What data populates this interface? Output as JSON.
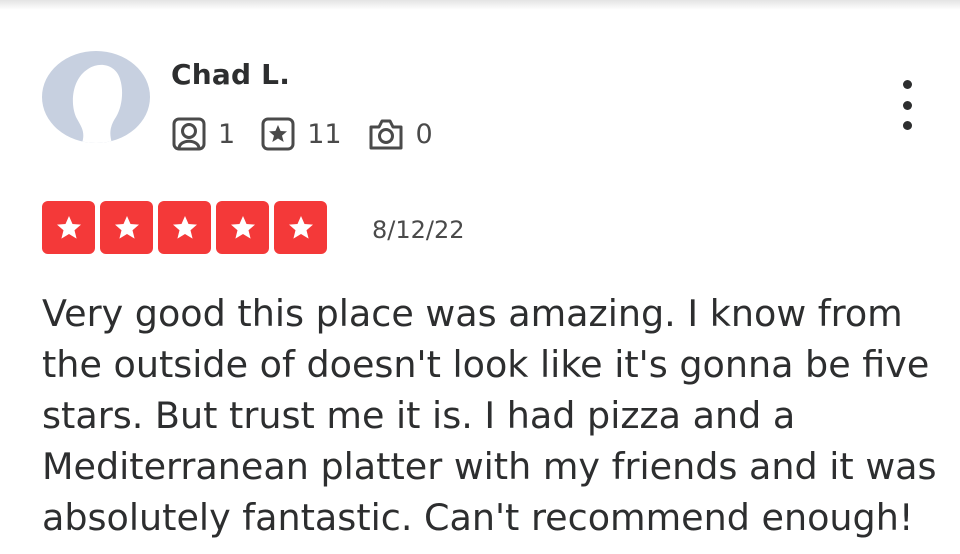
{
  "user": {
    "name": "Chad L.",
    "avatar_icon": "default-avatar-silhouette-icon",
    "stats": {
      "friends": "1",
      "reviews": "11",
      "photos": "0"
    }
  },
  "review": {
    "rating": 5,
    "rating_max": 5,
    "date": "8/12/22",
    "text": "Very good this place was amazing. I know from the outside of doesn't look like it's gonna be five stars. But trust me it is. I had pizza and a Mediterranean platter with my friends and it was absolutely fantastic. Can't recommend enough!"
  },
  "colors": {
    "star_red": "#f43939",
    "text": "#2d2e2f",
    "avatar_bg": "#c7d0e0"
  }
}
